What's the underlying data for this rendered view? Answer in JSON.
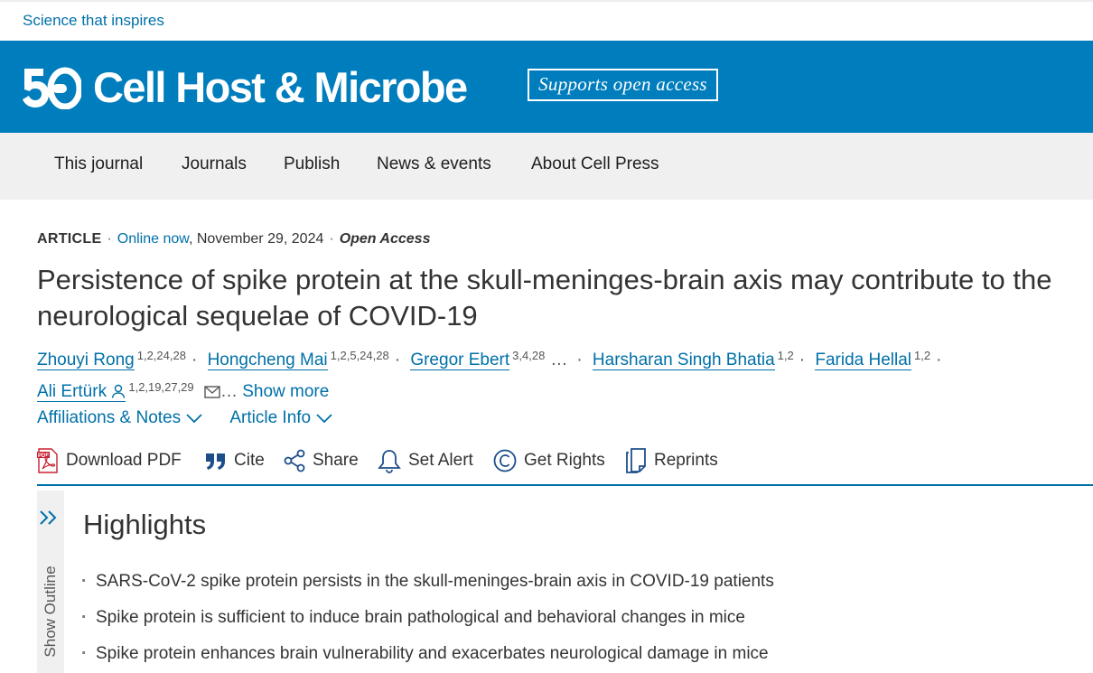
{
  "top": {
    "tagline": "Science that inspires"
  },
  "banner": {
    "logo_mark": "50",
    "journal_name": "Cell Host & Microbe",
    "open_access_badge": "Supports open access",
    "color": "#007dbc"
  },
  "nav": {
    "items": [
      {
        "label": "This journal"
      },
      {
        "label": "Journals"
      },
      {
        "label": "Publish"
      },
      {
        "label": "News & events"
      },
      {
        "label": "About Cell Press"
      }
    ]
  },
  "article": {
    "type": "ARTICLE",
    "status": "Online now",
    "date": ", November 29, 2024",
    "access": "Open Access",
    "title": "Persistence of spike protein at the skull-meninges-brain axis may contribute to the neurological sequelae of COVID-19",
    "authors": [
      {
        "name": "Zhouyi Rong",
        "affiliations": "1,2,24,28"
      },
      {
        "name": "Hongcheng Mai",
        "affiliations": "1,2,5,24,28"
      },
      {
        "name": "Gregor Ebert",
        "affiliations": "3,4,28"
      },
      {
        "name": "Harsharan Singh Bhatia",
        "affiliations": "1,2"
      },
      {
        "name": "Farida Hellal",
        "affiliations": "1,2"
      },
      {
        "name": "Ali Ertürk",
        "affiliations": "1,2,19,27,29",
        "icons": [
          "person-icon",
          "mail-icon"
        ]
      }
    ],
    "ellipsis": "…",
    "show_more": "Show more",
    "expanders": [
      {
        "label": "Affiliations & Notes"
      },
      {
        "label": "Article Info"
      }
    ],
    "actions": [
      {
        "label": "Download PDF",
        "icon": "pdf-icon"
      },
      {
        "label": "Cite",
        "icon": "quote-icon"
      },
      {
        "label": "Share",
        "icon": "share-icon"
      },
      {
        "label": "Set Alert",
        "icon": "bell-icon"
      },
      {
        "label": "Get Rights",
        "icon": "copyright-icon"
      },
      {
        "label": "Reprints",
        "icon": "reprints-icon"
      }
    ],
    "accent_color": "#0070a8"
  },
  "outline": {
    "label": "Show Outline"
  },
  "highlights": {
    "heading": "Highlights",
    "items": [
      "SARS-CoV-2 spike protein persists in the skull-meninges-brain axis in COVID-19 patients",
      "Spike protein is sufficient to induce brain pathological and behavioral changes in mice",
      "Spike protein enhances brain vulnerability and exacerbates neurological damage in mice"
    ]
  }
}
